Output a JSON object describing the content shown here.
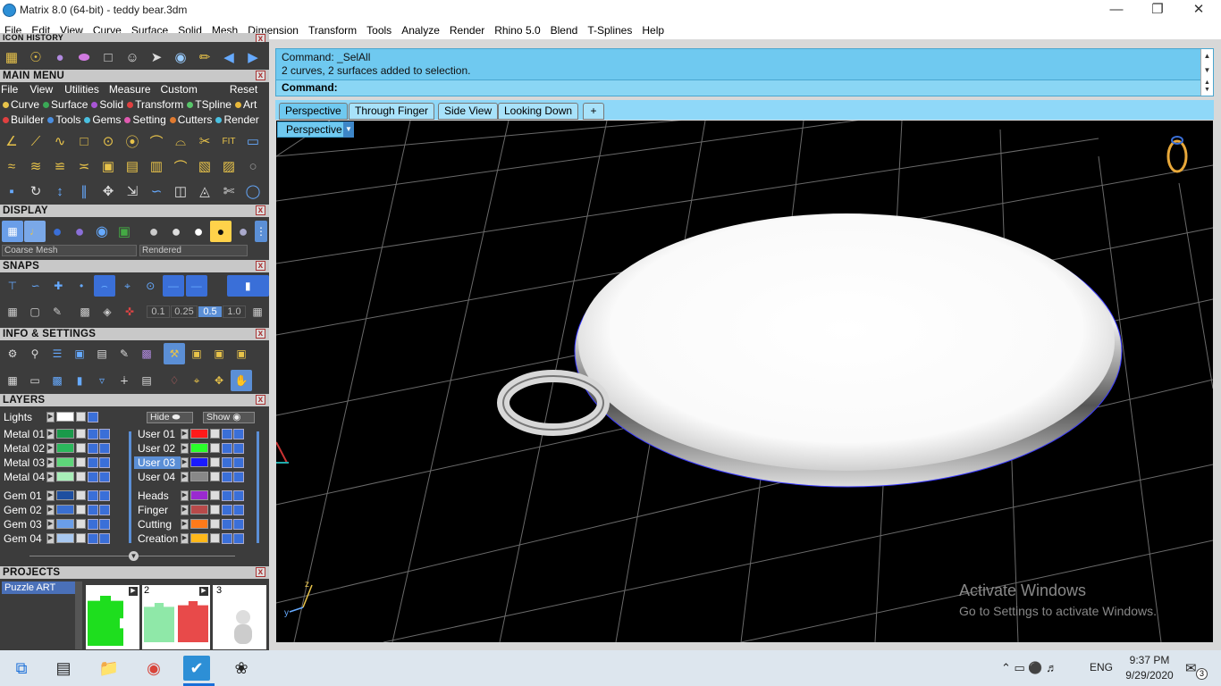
{
  "window": {
    "title": "Matrix 8.0 (64-bit) - teddy bear.3dm"
  },
  "menubar": [
    "File",
    "Edit",
    "View",
    "Curve",
    "Surface",
    "Solid",
    "Mesh",
    "Dimension",
    "Transform",
    "Tools",
    "Analyze",
    "Render",
    "Rhino 5.0",
    "Blend",
    "T-Splines",
    "Help"
  ],
  "left": {
    "icon_history": "ICON HISTORY",
    "main_menu": "MAIN MENU",
    "main_menu_items": [
      "File",
      "View",
      "Utilities",
      "Measure",
      "Custom"
    ],
    "reset": "Reset",
    "categories_row1": [
      {
        "label": "Curve",
        "color": "#e8c34a"
      },
      {
        "label": "Surface",
        "color": "#3aa856"
      },
      {
        "label": "Solid",
        "color": "#a855d6"
      },
      {
        "label": "Transform",
        "color": "#e04040"
      },
      {
        "label": "TSpline",
        "color": "#58c66a"
      },
      {
        "label": "Art",
        "color": "#e8b83a"
      }
    ],
    "categories_row2": [
      {
        "label": "Builder",
        "color": "#e04040"
      },
      {
        "label": "Tools",
        "color": "#4a8ee0"
      },
      {
        "label": "Gems",
        "color": "#4ac0e0"
      },
      {
        "label": "Setting",
        "color": "#e05ab0"
      },
      {
        "label": "Cutters",
        "color": "#e07a30"
      },
      {
        "label": "Render",
        "color": "#4ac0e0"
      }
    ],
    "display": "DISPLAY",
    "display_mesh": "Coarse Mesh",
    "display_mode": "Rendered",
    "snaps": "SNAPS",
    "snap_values": [
      "0.1",
      "0.25",
      "0.5",
      "1.0"
    ],
    "info_settings": "INFO & SETTINGS",
    "layers": "LAYERS",
    "lights": "Lights",
    "hide": "Hide",
    "show": "Show",
    "layers_left": [
      {
        "name": "Metal 01",
        "color": "#1a9a4a"
      },
      {
        "name": "Metal 02",
        "color": "#2cb85c"
      },
      {
        "name": "Metal 03",
        "color": "#5ed67a"
      },
      {
        "name": "Metal 04",
        "color": "#a8eeb8"
      },
      {
        "name": "Gem 01",
        "color": "#1e4fa0"
      },
      {
        "name": "Gem 02",
        "color": "#3a6fd0"
      },
      {
        "name": "Gem 03",
        "color": "#6a9ee8"
      },
      {
        "name": "Gem 04",
        "color": "#a8c8f0"
      }
    ],
    "layers_right": [
      {
        "name": "User 01",
        "color": "#ff1a1a",
        "selected": false
      },
      {
        "name": "User 02",
        "color": "#2aff2a",
        "selected": false
      },
      {
        "name": "User 03",
        "color": "#1a1aff",
        "selected": true
      },
      {
        "name": "User 04",
        "color": "#888888",
        "selected": false
      },
      {
        "name": "Heads",
        "color": "#9a2ad0",
        "selected": false
      },
      {
        "name": "Finger",
        "color": "#b84a4a",
        "selected": false
      },
      {
        "name": "Cutting",
        "color": "#ff7a1a",
        "selected": false
      },
      {
        "name": "Creation",
        "color": "#ffb81a",
        "selected": false
      }
    ],
    "projects": "PROJECTS",
    "project_name": "Puzzle ART",
    "project_thumbs": [
      "2",
      "3"
    ]
  },
  "command": {
    "line1": "Command: _SelAll",
    "line2": "2 curves, 2 surfaces added to selection.",
    "prompt": "Command:"
  },
  "tabs": [
    "Perspective",
    "Through Finger",
    "Side View",
    "Looking Down"
  ],
  "tab_add": "+",
  "viewport": {
    "label": "Perspective",
    "watermark_title": "Activate Windows",
    "watermark_sub": "Go to Settings to activate Windows.",
    "axis_z": "z",
    "axis_y": "y"
  },
  "taskbar": {
    "time": "9:37 PM",
    "date": "9/29/2020",
    "lang": "ENG",
    "notif": "3"
  }
}
